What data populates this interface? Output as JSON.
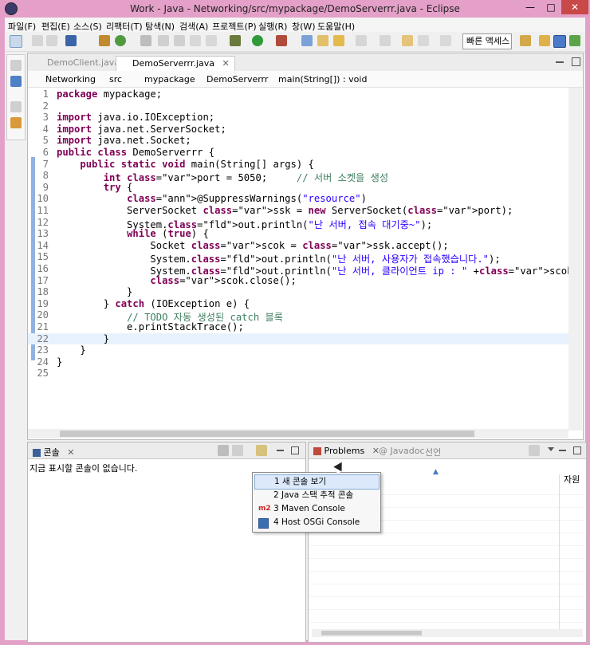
{
  "window": {
    "title": "Work - Java - Networking/src/mypackage/DemoServerrr.java - Eclipse",
    "minimize": "—",
    "maximize": "□",
    "close": "✕"
  },
  "menu": [
    "파일(F)",
    "편집(E)",
    "소스(S)",
    "리팩터(T)",
    "탐색(N)",
    "검색(A)",
    "프로젝트(P)",
    "실행(R)",
    "창(W)",
    "도움말(H)"
  ],
  "quick_access": "빠른 액세스",
  "editor": {
    "tabs": [
      {
        "label": "DemoClient.java",
        "active": false
      },
      {
        "label": "DemoServerrr.java",
        "active": true
      }
    ],
    "tab_close": "✕",
    "breadcrumb": [
      "Networking",
      "src",
      "mypackage",
      "DemoServerrr",
      "main(String[]) : void"
    ],
    "lines": [
      {
        "n": "1",
        "text": "package mypackage;"
      },
      {
        "n": "2",
        "text": ""
      },
      {
        "n": "3",
        "text": "import java.io.IOException;"
      },
      {
        "n": "4",
        "text": "import java.net.ServerSocket;"
      },
      {
        "n": "5",
        "text": "import java.net.Socket;"
      },
      {
        "n": "6",
        "text": "public class DemoServerrr {"
      },
      {
        "n": "7",
        "text": "    public static void main(String[] args) {"
      },
      {
        "n": "8",
        "text": "        int port = 5050;     // 서버 소켓을 생성"
      },
      {
        "n": "9",
        "text": "        try {"
      },
      {
        "n": "10",
        "text": "            @SuppressWarnings(\"resource\")"
      },
      {
        "n": "11",
        "text": "            ServerSocket ssk = new ServerSocket(port);"
      },
      {
        "n": "12",
        "text": "            System.out.println(\"난 서버, 접속 대기중~\");"
      },
      {
        "n": "13",
        "text": "            while (true) {"
      },
      {
        "n": "14",
        "text": "                Socket scok = ssk.accept();"
      },
      {
        "n": "15",
        "text": "                System.out.println(\"난 서버, 사용자가 접속했습니다.\");"
      },
      {
        "n": "16",
        "text": "                System.out.println(\"난 서버, 클라이언트 ip : \" +scok.getInetAddress().getH"
      },
      {
        "n": "17",
        "text": "                scok.close();"
      },
      {
        "n": "18",
        "text": "            }"
      },
      {
        "n": "19",
        "text": "        } catch (IOException e) {"
      },
      {
        "n": "20",
        "text": "            // TODO 자동 생성된 catch 블록"
      },
      {
        "n": "21",
        "text": "            e.printStackTrace();"
      },
      {
        "n": "22",
        "text": "        }"
      },
      {
        "n": "23",
        "text": "    }"
      },
      {
        "n": "24",
        "text": "}"
      },
      {
        "n": "25",
        "text": ""
      }
    ]
  },
  "console": {
    "tab_label": "콘솔",
    "tab_close": "✕",
    "message": "지금 표시할 콘솔이 없습니다."
  },
  "problems": {
    "tabs": [
      "Problems",
      "Javadoc",
      "선언"
    ],
    "tab_close": "✕",
    "column_resource": "자원"
  },
  "popup_menu": {
    "items": [
      {
        "label": "1 새 콘솔 보기",
        "icon": "",
        "highlighted": true
      },
      {
        "label": "2 Java 스택 추적 콘솔",
        "icon": "",
        "highlighted": false
      },
      {
        "label": "3 Maven Console",
        "icon": "m2",
        "highlighted": false
      },
      {
        "label": "4 Host OSGi Console",
        "icon": "osgi-icon",
        "highlighted": false
      }
    ]
  },
  "colors": {
    "frame": "#e3a1c8",
    "keyword": "#7f0055",
    "string": "#2a00ff",
    "comment": "#3f7f5f",
    "highlight_line": "#e8f2fe"
  }
}
